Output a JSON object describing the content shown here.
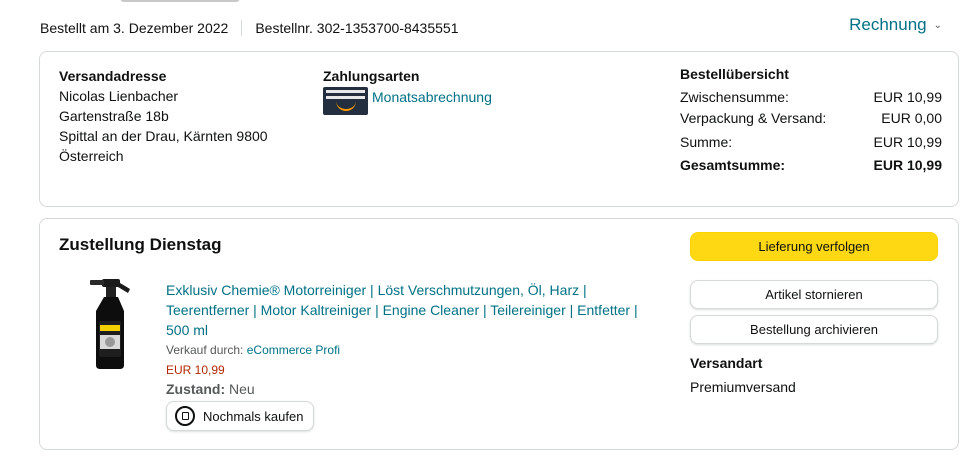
{
  "order": {
    "date_text": "Bestellt am 3. Dezember 2022",
    "number_text": "Bestellnr. 302-1353700-8435551",
    "invoice_label": "Rechnung"
  },
  "address": {
    "heading": "Versandadresse",
    "lines": [
      "Nicolas Lienbacher",
      "Gartenstraße 18b",
      "Spittal an der Drau, Kärnten 9800",
      "Österreich"
    ]
  },
  "payment": {
    "heading": "Zahlungsarten",
    "method": "Monatsabrechnung"
  },
  "summary": {
    "heading": "Bestellübersicht",
    "rows": [
      {
        "label": "Zwischensumme:",
        "value": "EUR 10,99"
      },
      {
        "label": "Verpackung & Versand:",
        "value": "EUR 0,00"
      },
      {
        "label": "Summe:",
        "value": "EUR 10,99"
      },
      {
        "label": "Gesamtsumme:",
        "value": "EUR 10,99"
      }
    ]
  },
  "delivery": {
    "title": "Zustellung Dienstag",
    "product": {
      "title": "Exklusiv Chemie® Motorreiniger | Löst Verschmutzungen, Öl, Harz | Teerentferner | Motor Kaltreiniger | Engine Cleaner | Teilereiniger | Entfetter | 500 ml",
      "sold_by_label": "Verkauf durch:",
      "sold_by": "eCommerce Profi",
      "price": "EUR 10,99",
      "condition_label": "Zustand:",
      "condition": "Neu",
      "rebuy_label": "Nochmals kaufen"
    },
    "buttons": {
      "track": "Lieferung verfolgen",
      "cancel": "Artikel stornieren",
      "archive": "Bestellung archivieren"
    },
    "shipping_heading": "Versandart",
    "shipping_value": "Premiumversand"
  },
  "colors": {
    "link": "#007185",
    "price": "#b12704",
    "primary_button": "#ffd814"
  }
}
